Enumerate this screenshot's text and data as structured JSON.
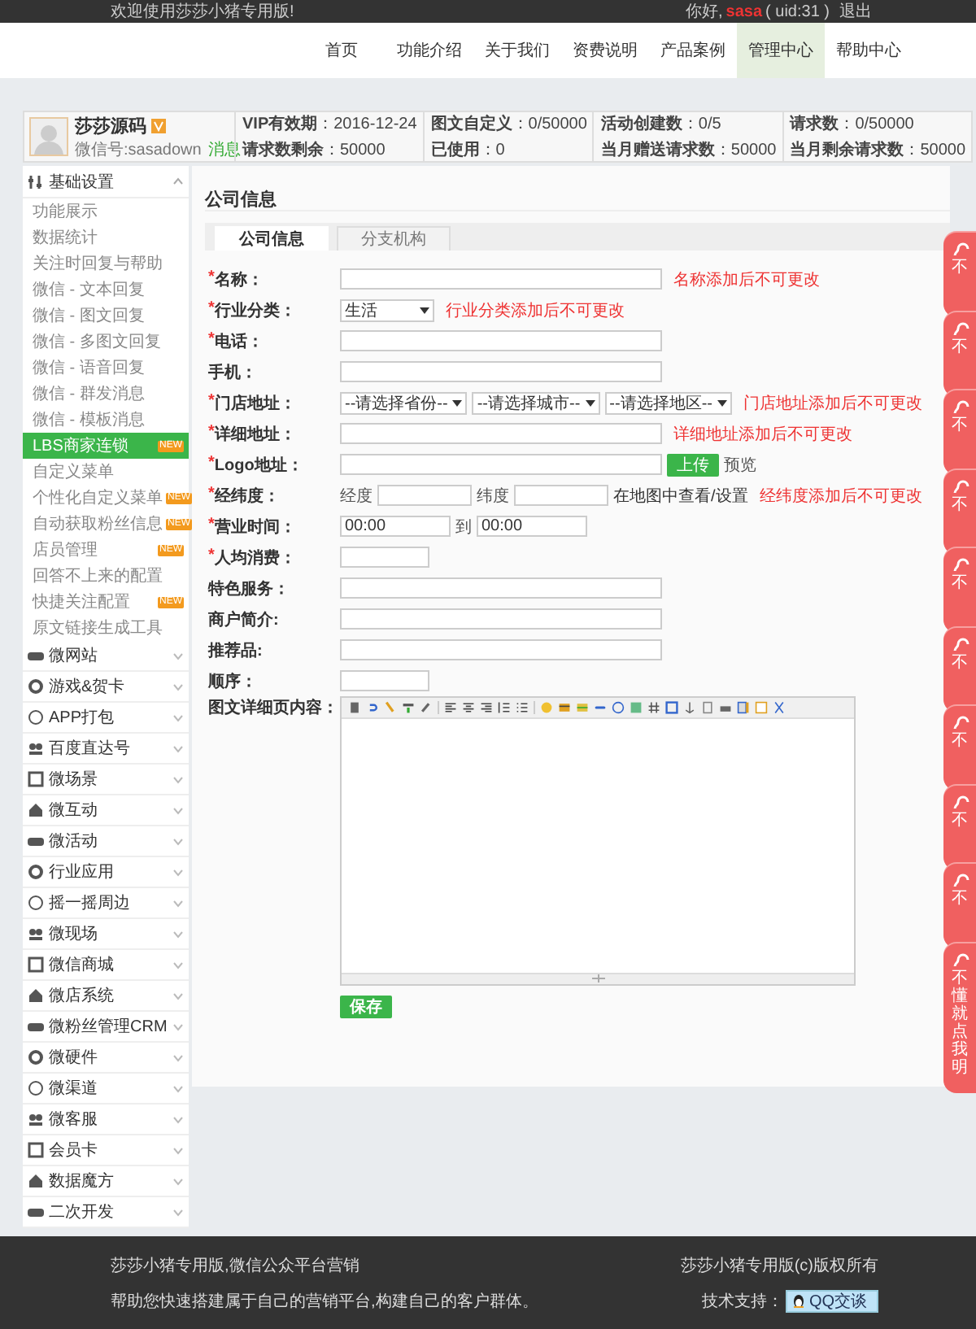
{
  "topbar": {
    "welcome": "欢迎使用莎莎小猪专用版!",
    "greeting": "你好,",
    "username": "sasa",
    "uid": "( uid:31 )",
    "logout": "退出"
  },
  "nav": [
    {
      "label": "首页",
      "selected": false
    },
    {
      "label": "功能介绍",
      "selected": false
    },
    {
      "label": "关于我们",
      "selected": false
    },
    {
      "label": "资费说明",
      "selected": false
    },
    {
      "label": "产品案例",
      "selected": false
    },
    {
      "label": "管理中心",
      "selected": true
    },
    {
      "label": "帮助中心",
      "selected": false
    }
  ],
  "account": {
    "name": "莎莎源码",
    "wechat": "微信号:sasadown",
    "message": "消息",
    "stats": [
      {
        "lines": [
          "**VIP有效期**：2016-12-24",
          "**请求数剩余**：50000"
        ]
      },
      {
        "lines": [
          "**图文自定义**：0/50000",
          "**已使用**：0"
        ]
      },
      {
        "lines": [
          "**活动创建数**：0/5",
          "**当月赠送请求数**：50000"
        ]
      },
      {
        "lines": [
          "**请求数**：0/50000",
          "**当月剩余请求数**：50000"
        ]
      }
    ]
  },
  "sidebar": {
    "sections": [
      {
        "label": "基础设置",
        "expanded": true,
        "items": [
          {
            "label": "功能展示",
            "selected": false
          },
          {
            "label": "数据统计",
            "selected": false
          },
          {
            "label": "关注时回复与帮助",
            "selected": false
          },
          {
            "label": "微信 - 文本回复",
            "selected": false
          },
          {
            "label": "微信 - 图文回复",
            "selected": false
          },
          {
            "label": "微信 - 多图文回复",
            "selected": false
          },
          {
            "label": "微信 - 语音回复",
            "selected": false
          },
          {
            "label": "微信 - 群发消息",
            "selected": false
          },
          {
            "label": "微信 - 模板消息",
            "selected": false
          },
          {
            "label": "LBS商家连锁",
            "selected": true,
            "badge": "NEW"
          },
          {
            "label": "自定义菜单",
            "selected": false
          },
          {
            "label": "个性化自定义菜单",
            "selected": false,
            "badge": "NEW"
          },
          {
            "label": "自动获取粉丝信息",
            "selected": false,
            "badge": "NEW"
          },
          {
            "label": "店员管理",
            "selected": false,
            "badge": "NEW"
          },
          {
            "label": "回答不上来的配置",
            "selected": false
          },
          {
            "label": "快捷关注配置",
            "selected": false,
            "badge": "NEW"
          },
          {
            "label": "原文链接生成工具",
            "selected": false
          }
        ]
      },
      {
        "label": "微网站",
        "expanded": false
      },
      {
        "label": "游戏&贺卡",
        "expanded": false
      },
      {
        "label": "APP打包",
        "expanded": false
      },
      {
        "label": "百度直达号",
        "expanded": false
      },
      {
        "label": "微场景",
        "expanded": false
      },
      {
        "label": "微互动",
        "expanded": false
      },
      {
        "label": "微活动",
        "expanded": false
      },
      {
        "label": "行业应用",
        "expanded": false
      },
      {
        "label": "摇一摇周边",
        "expanded": false
      },
      {
        "label": "微现场",
        "expanded": false
      },
      {
        "label": "微信商城",
        "expanded": false
      },
      {
        "label": "微店系统",
        "expanded": false
      },
      {
        "label": "微粉丝管理CRM",
        "expanded": false
      },
      {
        "label": "微硬件",
        "expanded": false
      },
      {
        "label": "微渠道",
        "expanded": false
      },
      {
        "label": "微客服",
        "expanded": false
      },
      {
        "label": "会员卡",
        "expanded": false
      },
      {
        "label": "数据魔方",
        "expanded": false
      },
      {
        "label": "二次开发",
        "expanded": false
      }
    ]
  },
  "page_title": "公司信息",
  "tabs": [
    {
      "label": "公司信息",
      "selected": true
    },
    {
      "label": "分支机构",
      "selected": false
    }
  ],
  "form": {
    "rows": [
      {
        "kind": "text",
        "mark": "*",
        "label": "名称：",
        "hint": "名称添加后不可更改"
      },
      {
        "kind": "select",
        "mark": "*",
        "label": "行业分类：",
        "value": "生活",
        "hint": "行业分类添加后不可更改"
      },
      {
        "kind": "text",
        "mark": "*",
        "label": "电话："
      },
      {
        "kind": "text",
        "label": "手机："
      },
      {
        "kind": "address",
        "mark": "*",
        "label": "门店地址：",
        "selects": [
          "--请选择省份--",
          "--请选择城市--",
          "--请选择地区--"
        ],
        "hint": "门店地址添加后不可更改"
      },
      {
        "kind": "text",
        "mark": "*",
        "label": "详细地址：",
        "hint": "详细地址添加后不可更改"
      },
      {
        "kind": "upload",
        "mark": "*",
        "label": "Logo地址：",
        "button": "上传",
        "link": "预览"
      },
      {
        "kind": "coords",
        "mark": "*",
        "label": "经纬度：",
        "lng_label": "经度",
        "lat_label": "纬度",
        "map_link": "在地图中查看/设置",
        "hint": "经纬度添加后不可更改"
      },
      {
        "kind": "time",
        "mark": "*",
        "label": "营业时间：",
        "from": "00:00",
        "to_label": "到",
        "to": "00:00"
      },
      {
        "kind": "short",
        "mark": "*",
        "label": "人均消费："
      },
      {
        "kind": "text",
        "label": "特色服务："
      },
      {
        "kind": "text",
        "label": "商户简介:"
      },
      {
        "kind": "text",
        "label": "推荐品:"
      },
      {
        "kind": "short",
        "label": "顺序："
      },
      {
        "kind": "editor",
        "label": "图文详细页内容："
      }
    ],
    "save": "保存"
  },
  "help_tabs": [
    {
      "text": "不"
    },
    {
      "text": "不"
    },
    {
      "text": "不"
    },
    {
      "text": "不"
    },
    {
      "text": "不"
    },
    {
      "text": "不"
    },
    {
      "text": "不"
    },
    {
      "text": "不"
    },
    {
      "text": "不"
    },
    {
      "text": "不懂就点我明"
    }
  ],
  "footer": {
    "brand": "莎莎小猪专用版,微信公众平台营销",
    "slogan": "帮助您快速搭建属于自己的营销平台,构建自己的客户群体。",
    "copyright": "莎莎小猪专用版(c)版权所有",
    "support": "技术支持：",
    "qq_button": "QQ交谈"
  }
}
